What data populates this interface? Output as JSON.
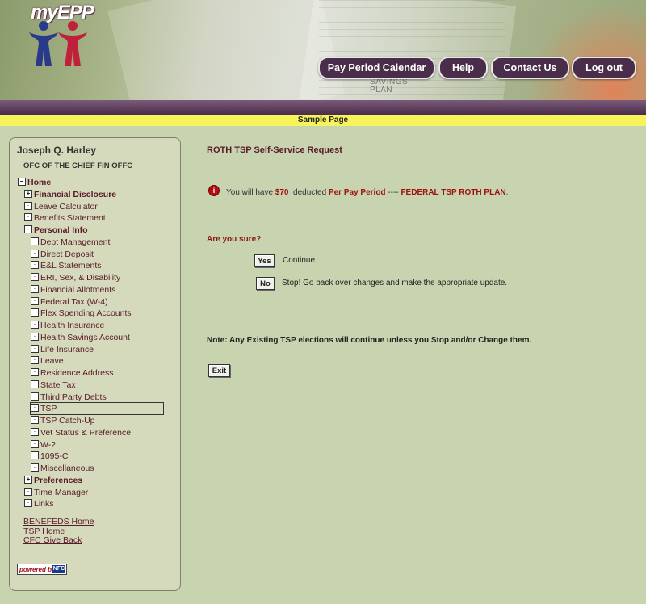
{
  "header": {
    "logo_text": "myEPP",
    "banner_text": [
      "SAVINGS",
      "PLAN"
    ],
    "nav": [
      {
        "label": "Pay Period Calendar"
      },
      {
        "label": "Help"
      },
      {
        "label": "Contact Us"
      },
      {
        "label": "Log out"
      }
    ],
    "sample_label": "Sample Page"
  },
  "colors": {
    "accent_purple": "#4a2d4a",
    "sample_bar": "#f7f35a",
    "link_maroon": "#5a1a28",
    "alert_red": "#a01010"
  },
  "sidebar": {
    "user_name": "Joseph Q. Harley",
    "office": "OFC OF THE CHIEF FIN OFFC",
    "tree": [
      {
        "label": "Home",
        "toggle": "−",
        "bold": true
      },
      {
        "label": "Financial Disclosure",
        "toggle": "+",
        "bold": true
      },
      {
        "label": "Leave Calculator",
        "toggle": "·"
      },
      {
        "label": "Benefits Statement",
        "toggle": "·"
      },
      {
        "label": "Personal Info",
        "toggle": "−",
        "bold": true
      },
      {
        "label": "Debt Management",
        "toggle": "·"
      },
      {
        "label": "Direct Deposit",
        "toggle": "·"
      },
      {
        "label": "E&L Statements",
        "toggle": "·"
      },
      {
        "label": "ERI, Sex, & Disability",
        "toggle": "·"
      },
      {
        "label": "Financial Allotments",
        "toggle": "·"
      },
      {
        "label": "Federal Tax (W-4)",
        "toggle": "·"
      },
      {
        "label": "Flex Spending Accounts",
        "toggle": "·"
      },
      {
        "label": "Health Insurance",
        "toggle": "·"
      },
      {
        "label": "Health Savings Account",
        "toggle": "·"
      },
      {
        "label": "Life Insurance",
        "toggle": "·"
      },
      {
        "label": "Leave",
        "toggle": "·"
      },
      {
        "label": "Residence Address",
        "toggle": "·"
      },
      {
        "label": "State Tax",
        "toggle": "·"
      },
      {
        "label": "Third Party Debts",
        "toggle": "·"
      },
      {
        "label": "TSP",
        "toggle": "·",
        "selected": true
      },
      {
        "label": "TSP Catch-Up",
        "toggle": "·"
      },
      {
        "label": "Vet Status & Preference",
        "toggle": "·"
      },
      {
        "label": "W-2",
        "toggle": "·"
      },
      {
        "label": "1095-C",
        "toggle": "·"
      },
      {
        "label": "Miscellaneous",
        "toggle": "·"
      },
      {
        "label": "Preferences",
        "toggle": "+",
        "bold": true
      },
      {
        "label": "Time Manager",
        "toggle": "·"
      },
      {
        "label": "Links",
        "toggle": "·"
      }
    ],
    "links": [
      "BENEFEDS Home",
      "TSP Home",
      "CFC Give Back"
    ],
    "powered_by": "powered by",
    "powered_logo": "NFC"
  },
  "main": {
    "title": "ROTH TSP Self-Service Request",
    "message": {
      "prefix": "You will have ",
      "amount": "$70",
      "middle": "  deducted ",
      "period": "Per Pay Period",
      "dash": " ---- ",
      "plan": "FEDERAL TSP ROTH PLAN",
      "suffix": "."
    },
    "confirm_question": "Are you sure?",
    "yes_button": "Yes",
    "yes_text": "Continue",
    "no_button": "No",
    "no_text": "Stop! Go back over changes and make the appropriate update.",
    "note": "Note: Any Existing TSP elections will continue unless you Stop and/or Change them.",
    "exit_button": "Exit"
  }
}
